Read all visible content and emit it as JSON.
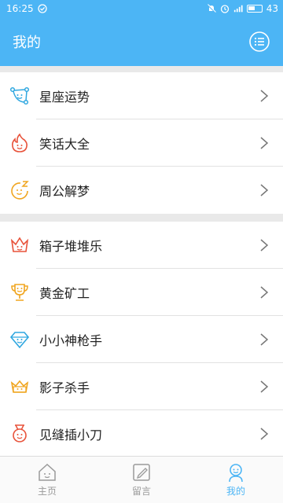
{
  "status_bar": {
    "time": "16:25",
    "battery": "43",
    "icons": [
      "check-circle-icon",
      "mute-icon",
      "alarm-icon",
      "signal-icon",
      "battery-icon"
    ]
  },
  "app_bar": {
    "title": "我的",
    "menu_icon": "list-menu-icon"
  },
  "sections": [
    {
      "items": [
        {
          "label": "星座运势",
          "icon": "constellation-icon",
          "color": "#2fa7e0"
        },
        {
          "label": "笑话大全",
          "icon": "flame-icon",
          "color": "#e8523a"
        },
        {
          "label": "周公解梦",
          "icon": "dream-icon",
          "color": "#f0a51f"
        }
      ]
    },
    {
      "items": [
        {
          "label": "箱子堆堆乐",
          "icon": "crown-icon",
          "color": "#e8523a"
        },
        {
          "label": "黄金矿工",
          "icon": "trophy-icon",
          "color": "#f0a51f"
        },
        {
          "label": "小小神枪手",
          "icon": "diamond-icon",
          "color": "#2fa7e0"
        },
        {
          "label": "影子杀手",
          "icon": "crown-box-icon",
          "color": "#f0a51f"
        },
        {
          "label": "见缝插小刀",
          "icon": "medal-icon",
          "color": "#e8523a"
        }
      ]
    }
  ],
  "tabs": [
    {
      "label": "主页",
      "icon": "home-icon",
      "active": false
    },
    {
      "label": "留言",
      "icon": "message-icon",
      "active": false
    },
    {
      "label": "我的",
      "icon": "profile-icon",
      "active": true
    }
  ],
  "colors": {
    "accent": "#4cb5f5",
    "background": "#e9e9e9",
    "inactive_tab": "#9a9a9a"
  }
}
